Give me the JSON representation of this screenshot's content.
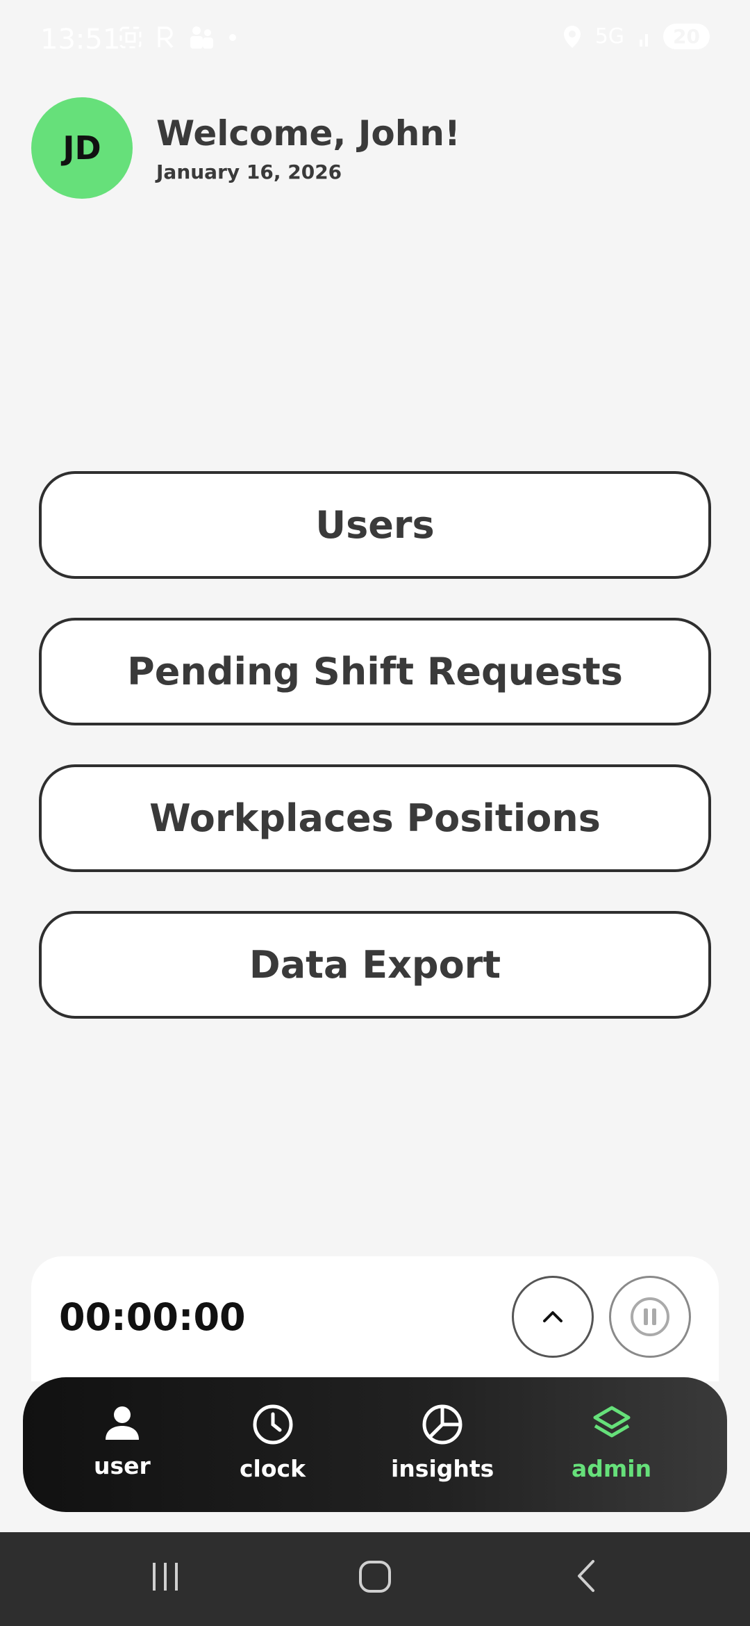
{
  "status_bar": {
    "time": "13:51",
    "left_icons": [
      "screenshot-icon",
      "r-icon",
      "people-icon",
      "dot-icon"
    ],
    "right_icons": [
      "location-icon",
      "5g-icon",
      "signal-icon"
    ],
    "network": "5G",
    "battery": "20"
  },
  "header": {
    "avatar_initials": "JD",
    "avatar_color": "#66e07a",
    "welcome": "Welcome, John!",
    "date": "January 16, 2026"
  },
  "menu": {
    "items": [
      {
        "label": "Users"
      },
      {
        "label": "Pending Shift Requests"
      },
      {
        "label": "Workplaces Positions"
      },
      {
        "label": "Data Export"
      }
    ]
  },
  "timer": {
    "value": "00:00:00",
    "expand_icon": "chevron-up-icon",
    "pause_icon": "pause-icon"
  },
  "bottom_nav": {
    "items": [
      {
        "label": "user",
        "icon": "user-icon"
      },
      {
        "label": "clock",
        "icon": "clock-icon"
      },
      {
        "label": "insights",
        "icon": "pie-chart-icon"
      },
      {
        "label": "admin",
        "icon": "layers-icon"
      }
    ],
    "active": "admin",
    "active_color": "#66e07a"
  },
  "system_nav": {
    "buttons": [
      "recents-icon",
      "home-icon",
      "back-icon"
    ]
  }
}
